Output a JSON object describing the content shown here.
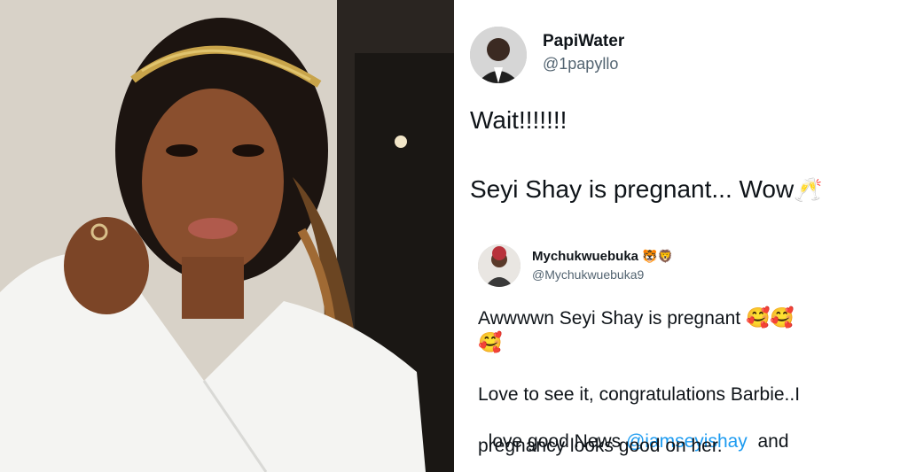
{
  "tweet1": {
    "display_name": "PapiWater",
    "handle": "@1papyllo",
    "line1": "Wait!!!!!!!",
    "line2": "Seyi Shay is pregnant... Wow",
    "emoji": "🥂"
  },
  "tweet2": {
    "display_name": "Mychukwuebuka",
    "name_emojis": "🐯🦁",
    "handle": "@Mychukwuebuka9",
    "line1": "Awwwwn Seyi Shay is pregnant",
    "emojis_line1": "🥰🥰",
    "emojis_line2": "🥰",
    "line3": "Love to see it, congratulations Barbie..I",
    "line4_prefix": "love good News ",
    "mention": "@iamseyishay",
    "line4_suffix": "  and",
    "line5": "pregnancy looks good on her."
  },
  "colors": {
    "mention": "#1d9bf0",
    "handle": "#536471",
    "text": "#0f1419"
  }
}
